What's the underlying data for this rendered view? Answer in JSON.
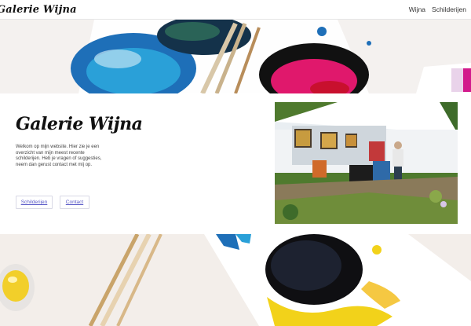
{
  "header": {
    "brand": "Galerie Wijna",
    "nav": [
      "Wijna",
      "Schilderijen"
    ]
  },
  "hero": {
    "title": "Galerie Wijna",
    "intro": "Welkom op mijn website. Hier zie je een overzicht van mijn meest recente schilderijen. Heb je vragen of suggesties, neem dan gerust contact met mij op.",
    "buttons": [
      "Schilderijen",
      "Contact"
    ]
  },
  "colors": {
    "accent": "#5a5ac8",
    "paint_blue": "#1e6fb8",
    "paint_pink": "#e0186c",
    "paint_yellow": "#f2d21a"
  }
}
